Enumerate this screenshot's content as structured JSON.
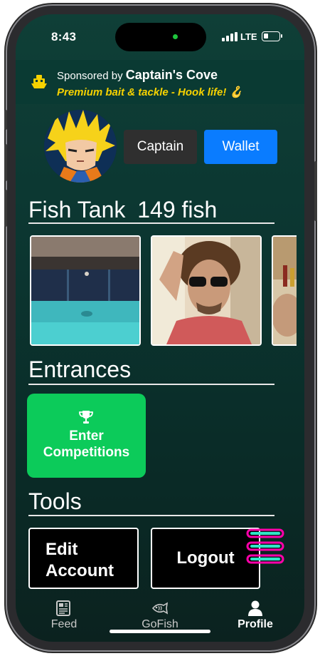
{
  "status_bar": {
    "time": "8:43",
    "network": "LTE"
  },
  "sponsor": {
    "prefix": "Sponsored by",
    "name": "Captain's Cove",
    "tagline": "Premium bait & tackle - Hook life! 🪝",
    "icon": "boat-icon"
  },
  "profile": {
    "avatar": "anime-character-avatar",
    "role_label": "Captain",
    "wallet_label": "Wallet"
  },
  "fish_tank": {
    "title": "Fish Tank",
    "count_label": "149 fish",
    "thumbnails": [
      "pool-photo",
      "selfie-sunglasses-photo",
      "partial-photo"
    ]
  },
  "entrances": {
    "title": "Entrances",
    "enter_competitions_label": "Enter Competitions",
    "icon": "trophy-icon"
  },
  "tools": {
    "title": "Tools",
    "edit_account_label": "Edit Account",
    "logout_label": "Logout",
    "stack_icon": "stack-icon"
  },
  "tab_bar": {
    "items": [
      {
        "label": "Feed",
        "icon": "newspaper-icon"
      },
      {
        "label": "GoFish",
        "icon": "fish-icon"
      },
      {
        "label": "Profile",
        "icon": "person-icon"
      }
    ],
    "active": "Profile"
  },
  "colors": {
    "background": "#0b3530",
    "sponsor_text": "#f7d200",
    "wallet_blue": "#0a7cff",
    "competition_green": "#0ccb5a"
  }
}
